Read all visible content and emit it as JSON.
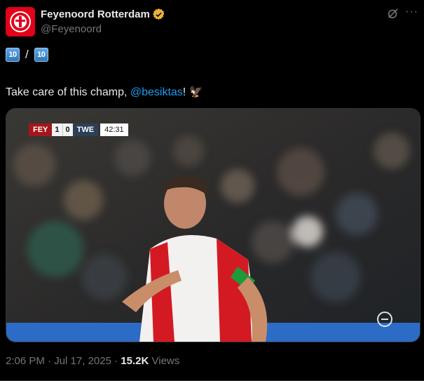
{
  "author": {
    "display_name": "Feyenoord Rotterdam",
    "handle": "@Feyenoord"
  },
  "tweet": {
    "counter_left": "10",
    "counter_sep": "/",
    "counter_right": "10",
    "text_before": "Take care of this champ, ",
    "mention": "@besiktas",
    "text_after": "! 🦅"
  },
  "media": {
    "scorebug": {
      "home": "FEY",
      "home_score": "1",
      "away_score": "0",
      "away": "TWE",
      "clock": "42:31"
    }
  },
  "meta": {
    "time": "2:06 PM",
    "date": "Jul 17, 2025",
    "views_count": "15.2K",
    "views_label": "Views"
  },
  "colors": {
    "background": "#000000",
    "text": "#e7e9ea",
    "muted": "#71767b",
    "link": "#1d9bf0",
    "brand": "#e2001a"
  },
  "icons": {
    "avatar": "feyenoord-crest",
    "verified": "gold-verified-badge",
    "grok": "grok-icon",
    "more": "more-icon"
  }
}
